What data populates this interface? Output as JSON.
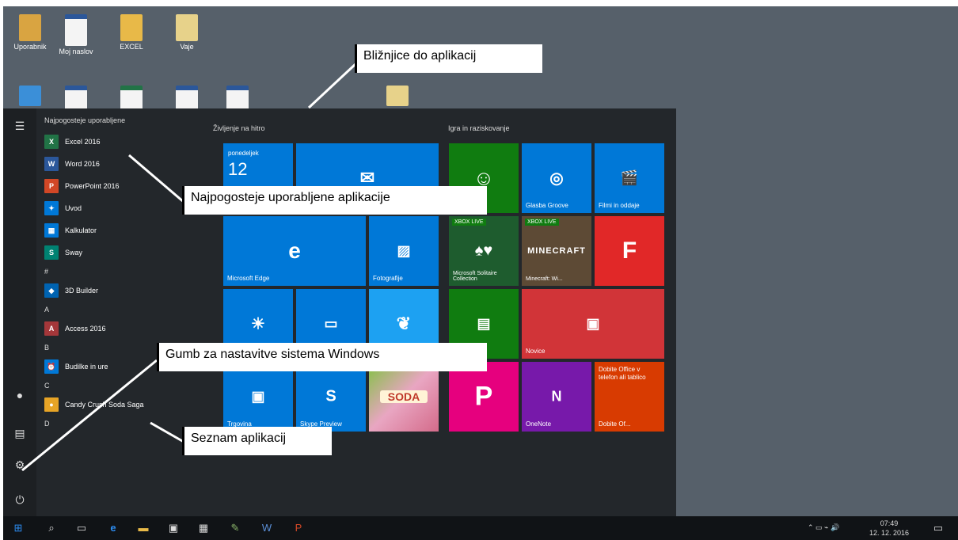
{
  "desktop": {
    "icons": [
      {
        "label": "Uporabnik",
        "kind": "user"
      },
      {
        "label": "Moj naslov",
        "kind": "doc"
      },
      {
        "label": "EXCEL",
        "kind": "folder"
      },
      {
        "label": "Vaje",
        "kind": "book"
      }
    ]
  },
  "start_menu": {
    "most_used_header": "Najpogosteje uporabljene",
    "apps": [
      {
        "label": "Excel 2016",
        "icon": "excel-icon",
        "color": "#217346",
        "glyph": "X"
      },
      {
        "label": "Word 2016",
        "icon": "word-icon",
        "color": "#2b579a",
        "glyph": "W"
      },
      {
        "label": "PowerPoint 2016",
        "icon": "powerpoint-icon",
        "color": "#d24726",
        "glyph": "P"
      },
      {
        "label": "Uvod",
        "icon": "lightbulb-icon",
        "color": "#0078d7",
        "glyph": "💡"
      },
      {
        "label": "Kalkulator",
        "icon": "calculator-icon",
        "color": "#0078d7",
        "glyph": "▦"
      },
      {
        "label": "Sway",
        "icon": "sway-icon",
        "color": "#008272",
        "glyph": "S"
      }
    ],
    "letter_hash": "#",
    "app_3d": "3D Builder",
    "letter_a": "A",
    "app_access": "Access 2016",
    "letter_b": "B",
    "app_budilka": "Budilke in ure",
    "letter_c": "C",
    "app_candy": "Candy Crush Soda Saga",
    "letter_d": "D",
    "group_life": "Življenje na hitro",
    "group_play": "Igra in raziskovanje",
    "tiles": {
      "calendar_day": "ponedeljek",
      "calendar_num": "12",
      "edge": "Microsoft Edge",
      "photos": "Fotografije",
      "groove": "Glasba Groove",
      "films": "Filmi in oddaje",
      "solitaire": "Microsoft Solitaire Collection",
      "minecraft": "Minecraft: Wi...",
      "novice": "Novice",
      "onenote": "OneNote",
      "store": "Trgovina",
      "skype": "Skype Preview",
      "office_promo": "Dobite Office v telefon ali tablico",
      "office_promo_label": "Dobite Of...",
      "xbox_live": "XBOX LIVE"
    }
  },
  "callouts": {
    "shortcuts": "Bližnjice do aplikacij",
    "most_used": "Najpogosteje uporabljene  aplikacije",
    "settings": "Gumb za nastavitve sistema Windows",
    "app_list": "Seznam aplikacij"
  },
  "taskbar": {
    "time": "07:49",
    "date": "12. 12. 2016"
  },
  "colors": {
    "accent": "#0078d7",
    "desktop": "#56606a",
    "start_bg": "#23272b"
  }
}
